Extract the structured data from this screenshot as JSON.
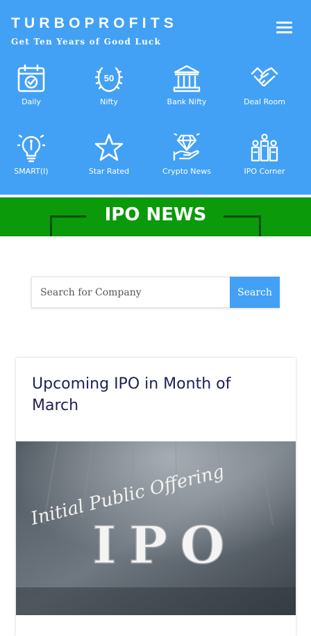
{
  "header": {
    "brand": "TURBOPROFITS",
    "tagline": "Get Ten Years of Good Luck",
    "menu_icon": "hamburger-menu-icon",
    "color": "#42a1f5"
  },
  "nav": {
    "items": [
      {
        "label": "Daily",
        "icon": "calendar-check-icon"
      },
      {
        "label": "Nifty",
        "icon": "nifty-50-laurel-icon"
      },
      {
        "label": "Bank Nifty",
        "icon": "bank-building-icon"
      },
      {
        "label": "Deal Room",
        "icon": "handshake-icon"
      },
      {
        "label": "SMART(I)",
        "icon": "lightbulb-icon"
      },
      {
        "label": "Star Rated",
        "icon": "star-icon"
      },
      {
        "label": "Crypto News",
        "icon": "diamond-hand-icon"
      },
      {
        "label": "IPO Corner",
        "icon": "people-podium-icon"
      }
    ]
  },
  "banner": {
    "title": "IPO NEWS",
    "color": "#0a9a0a"
  },
  "search": {
    "placeholder": "Search for Company",
    "button_label": "Search"
  },
  "article": {
    "title": "Upcoming IPO in Month of March",
    "image_text": {
      "script": "Initial Public Offering",
      "letters": "IPO"
    }
  }
}
